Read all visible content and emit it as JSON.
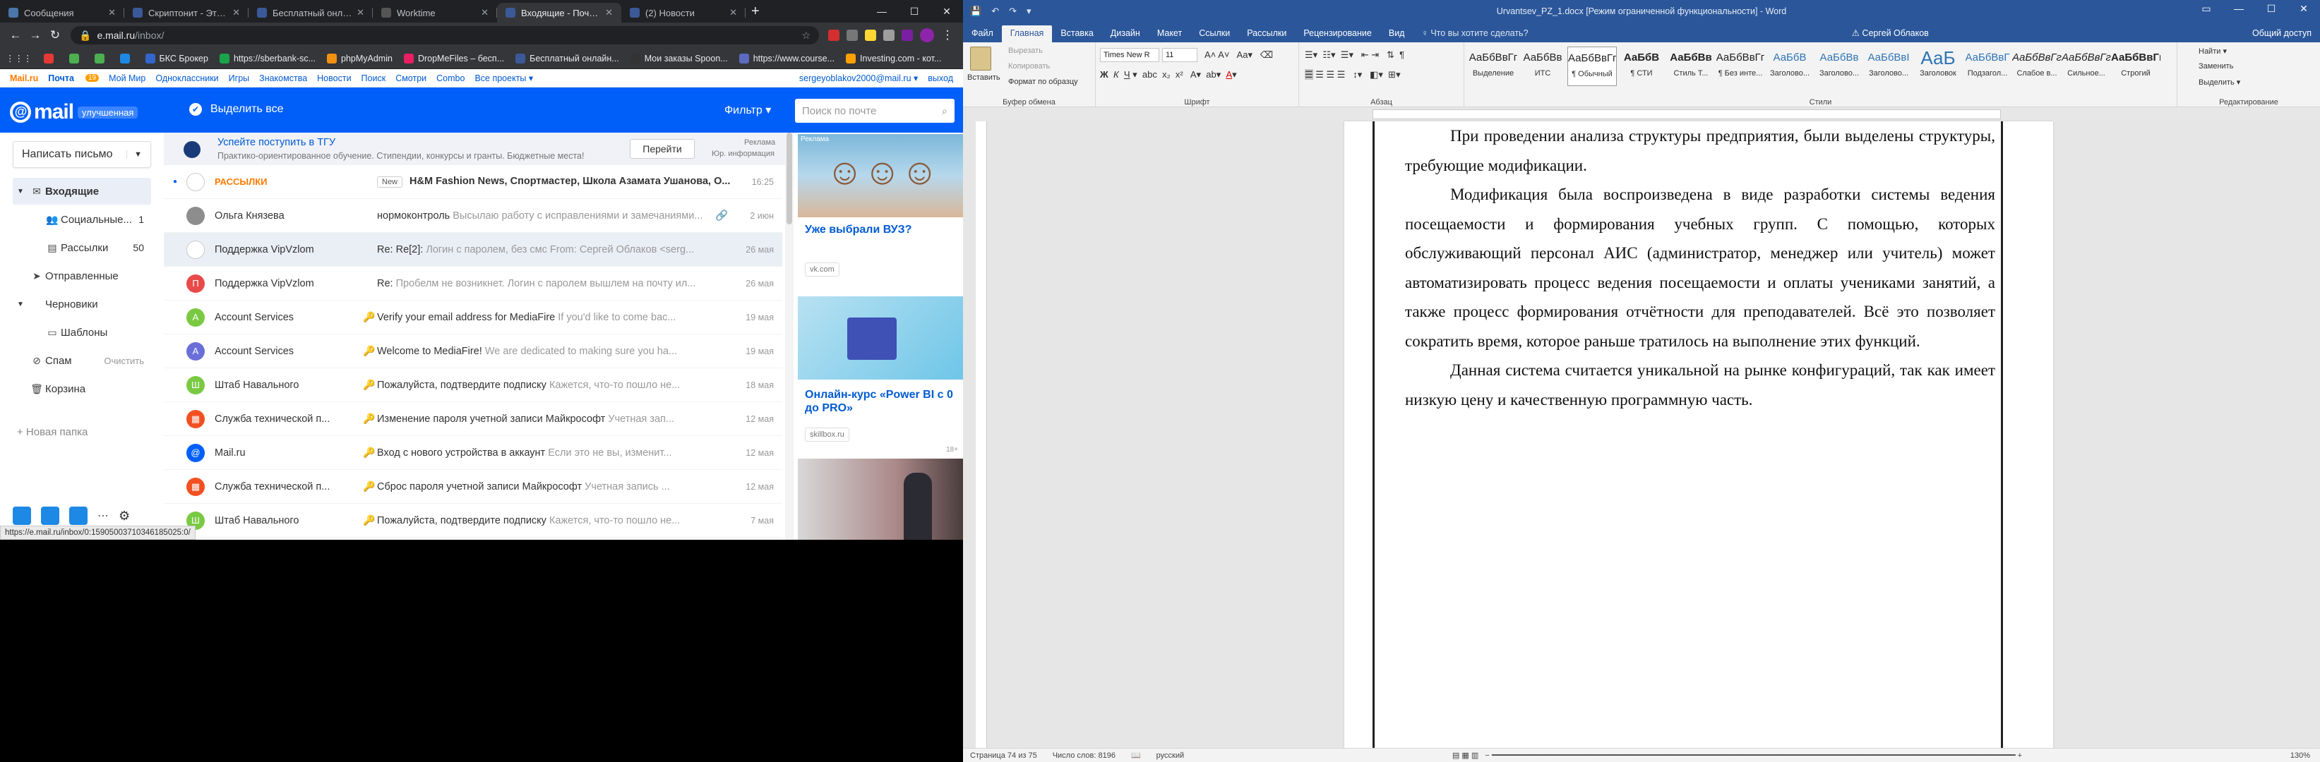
{
  "browser": {
    "tabs": [
      {
        "title": "Сообщения",
        "color": "#4a76a8"
      },
      {
        "title": "Скриптонит - Это Любо",
        "color": "#3b5998"
      },
      {
        "title": "Бесплатный онлайн ре",
        "color": "#3b5998"
      },
      {
        "title": "Worktime",
        "color": "#555555"
      },
      {
        "title": "Входящие - Почта Ma",
        "color": "#3b5998",
        "active": true
      },
      {
        "title": "(2) Новости",
        "color": "#3b5998"
      }
    ],
    "new_tab": "+",
    "controls": {
      "minimize": "—",
      "maximize": "☐",
      "close": "✕"
    },
    "nav": {
      "back": "←",
      "forward": "→",
      "reload": "↻"
    },
    "url_host": "e.mail.ru",
    "url_path": "/inbox/",
    "bookmarks": [
      {
        "label": "",
        "color": "#e53935"
      },
      {
        "label": "",
        "color": "#4caf50"
      },
      {
        "label": "",
        "color": "#4caf50"
      },
      {
        "label": "",
        "color": "#1e88e5"
      },
      {
        "label": "БКС Брокер",
        "color": "#3366cc"
      },
      {
        "label": "https://sberbank-sc...",
        "color": "#1aa34a"
      },
      {
        "label": "phpMyAdmin",
        "color": "#f29111"
      },
      {
        "label": "DropMeFiles – бесп...",
        "color": "#e91e63"
      },
      {
        "label": "Бесплатный онлайн...",
        "color": "#3b5998"
      },
      {
        "label": "Мои заказы Spoon...",
        "color": "#333333"
      },
      {
        "label": "https://www.course...",
        "color": "#5c6bc0"
      },
      {
        "label": "Investing.com - кот...",
        "color": "#ffa000"
      }
    ],
    "status_url": "https://e.mail.ru/inbox/0:15905003710346185025:0/"
  },
  "portal": {
    "items": [
      "Mail.ru",
      "Почта",
      "Мой Мир",
      "Одноклассники",
      "Игры",
      "Знакомства",
      "Новости",
      "Поиск",
      "Смотри",
      "Combo",
      "Все проекты ▾"
    ],
    "mail_badge": "19",
    "user_email": "sergeyoblakov2000@mail.ru ▾",
    "logout": "выход"
  },
  "mail": {
    "logo": "mail",
    "logo_sub": "улучшенная",
    "select_all": "Выделить все",
    "filter": "Фильтр ▾",
    "search_placeholder": "Поиск по почте",
    "compose": "Написать письмо",
    "folders": [
      {
        "label": "Входящие",
        "icon": "✉",
        "active": true,
        "arrow": "▼"
      },
      {
        "label": "Социальные...",
        "icon": "👥",
        "count": "1",
        "sub": true
      },
      {
        "label": "Рассылки",
        "icon": "▤",
        "count": "50",
        "sub": true
      },
      {
        "label": "Отправленные",
        "icon": "➤",
        "arrow": ""
      },
      {
        "label": "Черновики",
        "icon": "",
        "arrow": "▼"
      },
      {
        "label": "Шаблоны",
        "icon": "▭",
        "sub": true
      },
      {
        "label": "Спам",
        "icon": "⊘",
        "extra": "Очистить"
      },
      {
        "label": "Корзина",
        "icon": "🗑"
      }
    ],
    "new_folder": "+ Новая папка",
    "promo": {
      "title": "Успейте поступить в ТГУ",
      "text": "Практико-ориентированное обучение. Стипендии, конкурсы и гранты. Бюджетные места!",
      "button": "Перейти",
      "label": "Реклама",
      "info": "Юр. информация"
    },
    "messages": [
      {
        "from": "РАССЫЛКИ",
        "badge": "New",
        "subject": "H&M Fashion News, Спортмастер, Школа Азамата Ушанова, О...",
        "snippet": "",
        "date": "16:25",
        "avatar": "",
        "avatar_color": "#ffffff",
        "unread": true,
        "from_color": "#ff7a00"
      },
      {
        "from": "Ольга Князева",
        "subject": "нормоконтроль",
        "snippet": "Высылаю работу с исправлениями и замечаниями...",
        "date": "2 июн",
        "avatar": "",
        "avatar_color": "#8d8d8d",
        "attach": true
      },
      {
        "from": "Поддержка VipVzlom",
        "subject": "Re: Re[2]:",
        "snippet": "Логин с паролем, без смс From: Сергей Облаков <serg...",
        "date": "26 мая",
        "avatar": "",
        "avatar_color": "#ffffff",
        "selected": true
      },
      {
        "from": "Поддержка VipVzlom",
        "subject": "Re:",
        "snippet": "Пробелм не возникнет. Логин с паролем вышлем на почту ил...",
        "date": "26 мая",
        "avatar": "П",
        "avatar_color": "#e84a4a"
      },
      {
        "from": "Account Services",
        "subject": "Verify your email address for MediaFire",
        "snippet": "If you'd like to come bac...",
        "date": "19 мая",
        "avatar": "A",
        "avatar_color": "#7ac943"
      },
      {
        "from": "Account Services",
        "subject": "Welcome to MediaFire!",
        "snippet": "We are dedicated to making sure you ha...",
        "date": "19 мая",
        "avatar": "A",
        "avatar_color": "#6a6fd8"
      },
      {
        "from": "Штаб Навального",
        "subject": "Пожалуйста, подтвердите подписку",
        "snippet": "Кажется, что-то пошло не...",
        "date": "18 мая",
        "avatar": "Ш",
        "avatar_color": "#7ac943"
      },
      {
        "from": "Служба технической п...",
        "subject": "Изменение пароля учетной записи Майкрософт",
        "snippet": "Учетная зап...",
        "date": "12 мая",
        "avatar": "▦",
        "avatar_color": "#f25022"
      },
      {
        "from": "Mail.ru",
        "subject": "Вход с нового устройства в аккаунт",
        "snippet": "Если это не вы, изменит...",
        "date": "12 мая",
        "avatar": "@",
        "avatar_color": "#005ff9"
      },
      {
        "from": "Служба технической п...",
        "subject": "Сброс пароля учетной записи Майкрософт",
        "snippet": "Учетная запись ...",
        "date": "12 мая",
        "avatar": "▦",
        "avatar_color": "#f25022"
      },
      {
        "from": "Штаб Навального",
        "subject": "Пожалуйста, подтвердите подписку",
        "snippet": "Кажется, что-то пошло не...",
        "date": "7 мая",
        "avatar": "Ш",
        "avatar_color": "#7ac943"
      }
    ],
    "ads": [
      {
        "label": "Реклама",
        "title": "Уже выбрали ВУЗ?",
        "source": "vk.com"
      },
      {
        "title": "Онлайн-курс «Power BI с 0 до PRO»",
        "source": "skillbox.ru",
        "age": "18+"
      },
      {
        "title": ""
      }
    ]
  },
  "word": {
    "title": "Urvantsev_PZ_1.docx [Режим ограниченной функциональности] - Word",
    "quick_access": [
      "💾",
      "↶",
      "↷",
      "▾"
    ],
    "tabs": [
      "Файл",
      "Главная",
      "Вставка",
      "Дизайн",
      "Макет",
      "Ссылки",
      "Рассылки",
      "Рецензирование",
      "Вид"
    ],
    "active_tab": "Главная",
    "tell_me": "♀ Что вы хотите сделать?",
    "user": "⚠ Сергей Облаков",
    "share": "Общий доступ",
    "clipboard": {
      "paste": "Вставить",
      "cut": "Вырезать",
      "copy": "Копировать",
      "format": "Формат по образцу",
      "label": "Буфер обмена"
    },
    "font": {
      "name": "Times New R",
      "size": "11",
      "label": "Шрифт"
    },
    "paragraph_label": "Абзац",
    "styles": [
      {
        "preview": "АаБбВвГг",
        "name": "Выделение"
      },
      {
        "preview": "АаБбВв",
        "name": "ИТС"
      },
      {
        "preview": "АаБбВвГг",
        "name": "¶ Обычный",
        "active": true
      },
      {
        "preview": "АаБбВ",
        "name": "¶ СТИ"
      },
      {
        "preview": "АаБбВв",
        "name": "Стиль Т..."
      },
      {
        "preview": "АаБбВвГг",
        "name": "¶ Без инте..."
      },
      {
        "preview": "АаБбВ",
        "name": "Заголово..."
      },
      {
        "preview": "АаБбВв",
        "name": "Заголово..."
      },
      {
        "preview": "АаБбВвІ",
        "name": "Заголово..."
      },
      {
        "preview": "АаБ",
        "name": "Заголовок"
      },
      {
        "preview": "АаБбВвГ",
        "name": "Подзагол..."
      },
      {
        "preview": "АаБбВвГг",
        "name": "Слабое в..."
      },
      {
        "preview": "АаБбВвГг",
        "name": "Сильное..."
      },
      {
        "preview": "АаБбВвГг",
        "name": "Строгий"
      }
    ],
    "styles_label": "Стили",
    "editing": {
      "find": "Найти ▾",
      "replace": "Заменить",
      "select": "Выделить ▾",
      "label": "Редактирование"
    },
    "paragraphs": [
      "При проведении анализа структуры предприятия, были выделены структуры, требующие модификации.",
      "Модификация была воспроизведена в виде разработки системы ведения посещаемости и формирования учебных групп. С помощью, которых обслуживающий персонал АИС (администратор, менеджер или учитель) может автоматизировать процесс ведения посещаемости и оплаты учениками занятий, а также процесс формирования отчётности для преподавателей. Всё это позволяет сократить время, которое раньше тратилось на выполнение этих функций.",
      "Данная система считается уникальной на рынке конфигураций, так как имеет низкую цену и качественную программную часть."
    ],
    "status": {
      "page": "Страница 74 из 75",
      "words": "Число слов: 8196",
      "lang": "русский",
      "zoom": "130%"
    }
  }
}
